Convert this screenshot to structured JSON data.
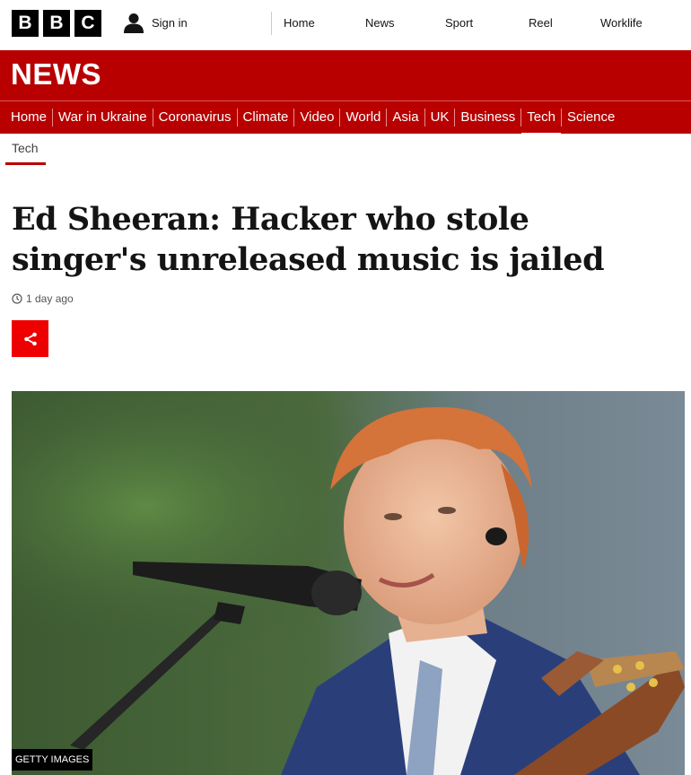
{
  "logo": {
    "letters": [
      "B",
      "B",
      "C"
    ]
  },
  "account": {
    "sign_in_label": "Sign in"
  },
  "top_nav": [
    "Home",
    "News",
    "Sport",
    "Reel",
    "Worklife"
  ],
  "news_banner": {
    "title": "NEWS"
  },
  "sub_nav": {
    "items": [
      "Home",
      "War in Ukraine",
      "Coronavirus",
      "Climate",
      "Video",
      "World",
      "Asia",
      "UK",
      "Business",
      "Tech",
      "Science"
    ],
    "active": "Tech"
  },
  "article": {
    "section": "Tech",
    "headline": "Ed Sheeran: Hacker who stole singer's unreleased music is jailed",
    "timestamp": "1 day ago",
    "image_credit": "GETTY IMAGES"
  },
  "colors": {
    "brand_red": "#b80000",
    "share_red": "#e00000"
  },
  "icons": {
    "account": "user-icon",
    "time": "clock-icon",
    "share": "share-icon"
  }
}
